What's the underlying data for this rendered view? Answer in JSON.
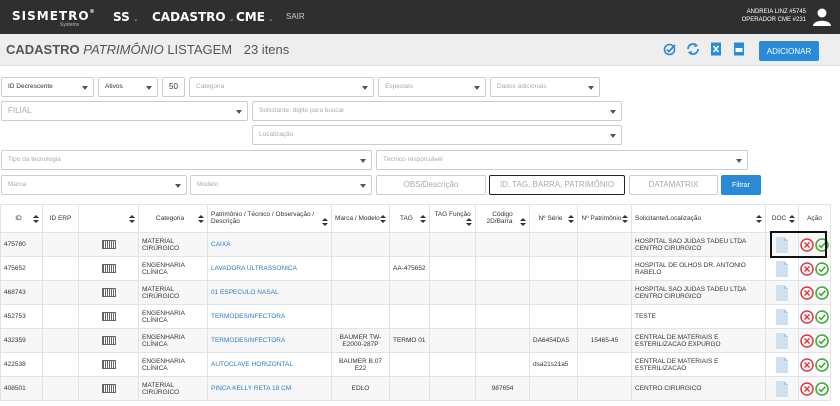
{
  "navbar": {
    "logo": "SISMETRO",
    "logo_reg": "®",
    "logo_sub": "Systems",
    "menu": [
      {
        "label": "SS",
        "caret": "⌄"
      },
      {
        "label": "CADASTRO",
        "caret": "⌄"
      },
      {
        "label": "CME",
        "caret": "⌄"
      }
    ],
    "sair": "SAIR",
    "user_line1": "ANDREIA LINZ #5745",
    "user_line2": "OPERADOR CME #231"
  },
  "title": {
    "bold": "CADASTRO",
    "italic": "PATRIMÔNIO",
    "normal": "LISTAGEM",
    "count": "23 itens"
  },
  "add_button": "ADICIONAR",
  "filters": {
    "order": "ID Decrescente",
    "status": "Ativos",
    "page_size": "50",
    "categoria": "Categoria",
    "especiais": "Especiais",
    "dados": "Dados adicionais",
    "filial": "FILIAL",
    "solicitante": "Solicitante, digite para buscar",
    "localizacao": "Localização",
    "tecnologia": "Tipo da tecnologia",
    "tecnico": "Técnico responsável",
    "marca": "Marca",
    "modelo": "Modelo",
    "obs": "OBS/Descrição",
    "id_tag": "ID, TAG, BARRA, PATRIMÔNIO",
    "datamatrix": "DATAMATRIX",
    "filtrar": "Filtrar"
  },
  "table": {
    "headers": [
      "ID",
      "ID ERP",
      "",
      "Categoria",
      "Patrimônio / Técnico / Observação / Descrição",
      "Marca / Modelo",
      "TAG",
      "TAG Função",
      "Código 2D/Barra",
      "Nº Série",
      "Nº Patrimônio",
      "Solicitante/Localização",
      "DOC",
      "Ação"
    ],
    "rows": [
      {
        "id": "475780",
        "erp": "",
        "categoria": "MATERIAL CIRÚRGICO",
        "desc": "CAIXA",
        "marca": "",
        "tag": "",
        "tagf": "",
        "cod": "",
        "serie": "",
        "pat": "",
        "sol": "HOSPITAL SAO JUDAS TADEU LTDA CENTRO CIRURGICO"
      },
      {
        "id": "475652",
        "erp": "",
        "categoria": "ENGENHARIA CLÍNICA",
        "desc": "LAVADORA ULTRASSONICA",
        "marca": "",
        "tag": "AA-475652",
        "tagf": "",
        "cod": "",
        "serie": "",
        "pat": "",
        "sol": "HOSPITAL DE OLHOS DR. ANTONIO RABELO"
      },
      {
        "id": "468743",
        "erp": "",
        "categoria": "MATERIAL CIRÚRGICO",
        "desc": "01 ESPECULO NASAL",
        "marca": "",
        "tag": "",
        "tagf": "",
        "cod": "",
        "serie": "",
        "pat": "",
        "sol": "HOSPITAL SAO JUDAS TADEU LTDA CENTRO CIRURGICO"
      },
      {
        "id": "452753",
        "erp": "",
        "categoria": "ENGENHARIA CLÍNICA",
        "desc": "TERMODESINFECTORA",
        "marca": "",
        "tag": "",
        "tagf": "",
        "cod": "",
        "serie": "",
        "pat": "",
        "sol": "TESTE"
      },
      {
        "id": "432359",
        "erp": "",
        "categoria": "ENGENHARIA CLÍNICA",
        "desc": "TERMODESINFECTORA",
        "marca": "BAUMER TW-E2000-287P",
        "tag": "TERMO 01",
        "tagf": "",
        "cod": "",
        "serie": "DA6454DA5",
        "pat": "15465-45",
        "sol": "CENTRAL DE MATERIAIS E ESTERILIZACAO EXPURGO"
      },
      {
        "id": "422538",
        "erp": "",
        "categoria": "ENGENHARIA CLÍNICA",
        "desc": "AUTOCLAVE HORIZONTAL",
        "marca": "BAUMER B.07 E22",
        "tag": "",
        "tagf": "",
        "cod": "",
        "serie": "dsa21s21a5",
        "pat": "",
        "sol": "CENTRAL DE MATERIAIS E ESTERILIZACAO"
      },
      {
        "id": "408501",
        "erp": "",
        "categoria": "MATERIAL CIRÚRGICO",
        "desc": "PINCA KELLY RETA 18 CM",
        "marca": "EDLO",
        "tag": "",
        "tagf": "",
        "cod": "987654",
        "serie": "",
        "pat": "",
        "sol": "CENTRO CIRURGICO"
      }
    ]
  },
  "colors": {
    "navbar": "#2f2f2f",
    "accent": "#2a8ad8",
    "link": "#2a7bc6",
    "cancel": "#e0393e",
    "confirm": "#3aaa35"
  },
  "icons": {
    "user": "user-icon",
    "tools": [
      "edit-check-icon",
      "refresh-icon",
      "excel-icon",
      "csv-icon"
    ],
    "doc": "document-icon",
    "cancel": "cancel-circle-icon",
    "confirm": "check-circle-icon"
  }
}
